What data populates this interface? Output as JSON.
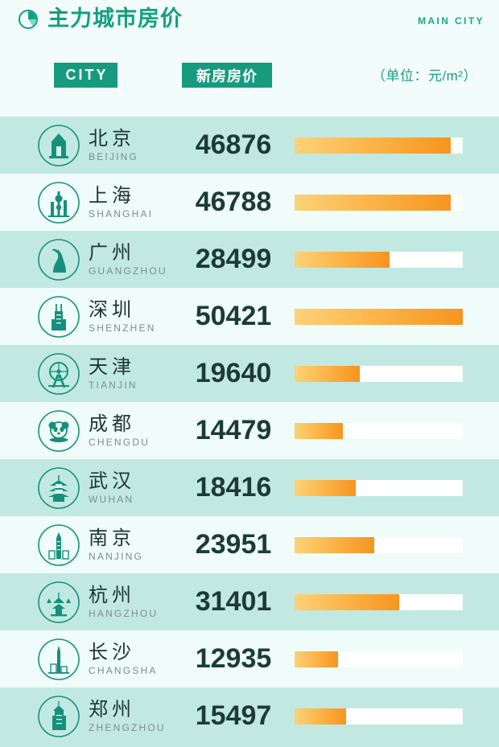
{
  "header": {
    "title": "主力城市房价",
    "subtitle": "MAIN CITY",
    "icon": "pie-chart-icon"
  },
  "columns": {
    "city_label": "CITY",
    "price_label": "新房房价",
    "unit_label": "（单位：元/m²）"
  },
  "colors": {
    "brand_green": "#169b7e",
    "title_green": "#13a07f",
    "band_dark": "#c1e9e2",
    "band_light": "#effcf9",
    "page_bg": "#f2fcfa",
    "bar_start": "#fcd278",
    "bar_end": "#f79420",
    "bar_track": "#ffffff",
    "value_text": "#1d3b35",
    "city_cn_text": "#1e3530",
    "city_en_text": "#7b8e8c"
  },
  "chart_data": {
    "type": "bar",
    "title": "主力城市房价",
    "subtitle": "MAIN CITY",
    "xlabel": "",
    "ylabel": "新房房价",
    "unit": "元/m²",
    "orientation": "horizontal",
    "grid": false,
    "legend": "none",
    "xlim": [
      0,
      50421
    ],
    "max_value": 50421,
    "categories": [
      "北京",
      "上海",
      "广州",
      "深圳",
      "天津",
      "成都",
      "武汉",
      "南京",
      "杭州",
      "长沙",
      "郑州"
    ],
    "categories_en": [
      "BEIJING",
      "SHANGHAI",
      "GUANGZHOU",
      "SHENZHEN",
      "TIANJIN",
      "CHENGDU",
      "WUHAN",
      "NANJING",
      "HANGZHOU",
      "CHANGSHA",
      "ZHENGZHOU"
    ],
    "values": [
      46876,
      46788,
      28499,
      50421,
      19640,
      14479,
      18416,
      23951,
      31401,
      12935,
      15497
    ]
  },
  "rows": [
    {
      "cn": "北京",
      "en": "BEIJING",
      "value": "46876",
      "pct": 92.97,
      "icon": "beijing-tiananmen-icon",
      "band": "a"
    },
    {
      "cn": "上海",
      "en": "SHANGHAI",
      "value": "46788",
      "pct": 92.79,
      "icon": "shanghai-pearl-tower-icon",
      "band": "b"
    },
    {
      "cn": "广州",
      "en": "GUANGZHOU",
      "value": "28499",
      "pct": 56.52,
      "icon": "guangzhou-goat-icon",
      "band": "a"
    },
    {
      "cn": "深圳",
      "en": "SHENZHEN",
      "value": "50421",
      "pct": 100.0,
      "icon": "shenzhen-diwang-icon",
      "band": "b"
    },
    {
      "cn": "天津",
      "en": "TIANJIN",
      "value": "19640",
      "pct": 38.95,
      "icon": "tianjin-eye-icon",
      "band": "a"
    },
    {
      "cn": "成都",
      "en": "CHENGDU",
      "value": "14479",
      "pct": 28.71,
      "icon": "chengdu-panda-icon",
      "band": "b"
    },
    {
      "cn": "武汉",
      "en": "WUHAN",
      "value": "18416",
      "pct": 36.52,
      "icon": "wuhan-yellow-crane-icon",
      "band": "a"
    },
    {
      "cn": "南京",
      "en": "NANJING",
      "value": "23951",
      "pct": 47.5,
      "icon": "nanjing-zifeng-icon",
      "band": "b"
    },
    {
      "cn": "杭州",
      "en": "HANGZHOU",
      "value": "31401",
      "pct": 62.28,
      "icon": "hangzhou-leifeng-pagoda-icon",
      "band": "a"
    },
    {
      "cn": "长沙",
      "en": "CHANGSHA",
      "value": "12935",
      "pct": 25.65,
      "icon": "changsha-ifs-tower-icon",
      "band": "b"
    },
    {
      "cn": "郑州",
      "en": "ZHENGZHOU",
      "value": "15497",
      "pct": 30.73,
      "icon": "zhengzhou-erqi-tower-icon",
      "band": "a"
    }
  ]
}
